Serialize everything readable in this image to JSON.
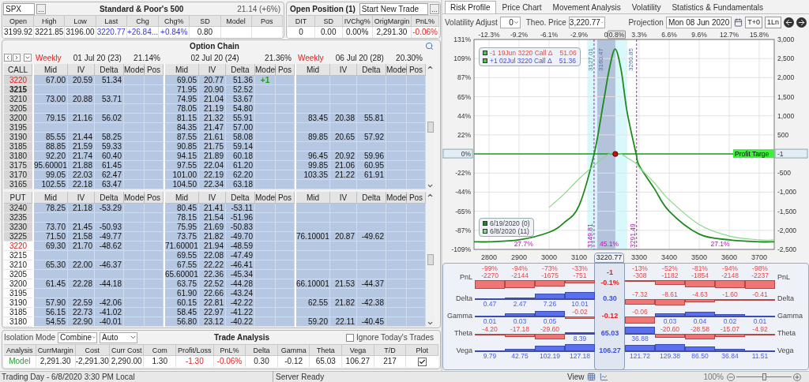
{
  "quote": {
    "symbol": "SPX",
    "browse": "...",
    "title": "Standard & Poor's 500",
    "iv": "21.14 (+6%)",
    "columns": [
      {
        "label": "Open",
        "value": "3199.92"
      },
      {
        "label": "High",
        "value": "3221.85"
      },
      {
        "label": "Low",
        "value": "3196.00"
      },
      {
        "label": "Last",
        "value": "3220.77",
        "kind": "gain"
      },
      {
        "label": "Chg",
        "value": "+26.84...",
        "kind": "gain"
      },
      {
        "label": "Chg%",
        "value": "+0.84%",
        "kind": "gain"
      },
      {
        "label": "SD",
        "value": "0.80"
      },
      {
        "label": "Model"
      },
      {
        "label": "Pos"
      }
    ]
  },
  "open_position": {
    "title": "Open Position (1)",
    "trade": "Start New Trade",
    "browse": "...",
    "columns": [
      {
        "label": "DIT",
        "value": "0"
      },
      {
        "label": "SD",
        "value": "0.00"
      },
      {
        "label": "IVChg%",
        "value": "0.00%"
      },
      {
        "label": "OrigMargin",
        "value": "2,291.30"
      },
      {
        "label": "PnL%",
        "value": "-0.06%",
        "kind": "loss"
      }
    ]
  },
  "option_chain": {
    "title": "Option Chain",
    "expiries": [
      {
        "tag": "Weekly",
        "date": "01 Jul 20 (23)",
        "iv": "21.14%"
      },
      {
        "date": "02 Jul 20 (24)",
        "iv": "21.36%"
      },
      {
        "tag": "Weekly",
        "date": "06 Jul 20 (28)",
        "iv": "20.30%"
      }
    ],
    "sections": [
      {
        "label": "CALL",
        "headers": [
          [
            "Mid",
            "IV",
            "Delta",
            "Model",
            "Pos"
          ],
          [
            "Mid",
            "IV",
            "Delta",
            "Model",
            "Pos"
          ],
          [
            "Mid",
            "IV",
            "Delta",
            "Model",
            "Pos"
          ]
        ],
        "rows": [
          {
            "strike": "3220",
            "itm": true,
            "position": true,
            "selected": false,
            "expiry_1": {
              "mid": "67.00",
              "iv": "20.59",
              "delta": "51.34"
            },
            "expiry_2": {
              "mid": "69.05",
              "iv": "20.77",
              "delta": "51.36",
              "model": "+1"
            }
          },
          {
            "strike": "3215",
            "itm": true,
            "position": false,
            "selected": true,
            "expiry_2": {
              "mid": "71.95",
              "iv": "20.90",
              "delta": "52.52"
            }
          },
          {
            "strike": "3210",
            "itm": true,
            "position": false,
            "selected": false,
            "expiry_1": {
              "mid": "73.00",
              "iv": "20.88",
              "delta": "53.71"
            },
            "expiry_2": {
              "mid": "74.95",
              "iv": "21.04",
              "delta": "53.67"
            }
          },
          {
            "strike": "3205",
            "itm": true,
            "position": false,
            "selected": false,
            "expiry_2": {
              "mid": "78.05",
              "iv": "21.19",
              "delta": "54.80"
            }
          },
          {
            "strike": "3200",
            "itm": true,
            "position": false,
            "selected": false,
            "expiry_1": {
              "mid": "79.15",
              "iv": "21.16",
              "delta": "56.02"
            },
            "expiry_2": {
              "mid": "81.15",
              "iv": "21.32",
              "delta": "55.91"
            },
            "expiry_3": {
              "mid": "83.45",
              "iv": "20.38",
              "delta": "55.81"
            }
          },
          {
            "strike": "3195",
            "itm": true,
            "position": false,
            "selected": false,
            "expiry_2": {
              "mid": "84.35",
              "iv": "21.47",
              "delta": "57.00"
            }
          },
          {
            "strike": "3190",
            "itm": true,
            "position": false,
            "selected": false,
            "expiry_1": {
              "mid": "85.55",
              "iv": "21.44",
              "delta": "58.25"
            },
            "expiry_2": {
              "mid": "87.55",
              "iv": "21.61",
              "delta": "58.08"
            },
            "expiry_3": {
              "mid": "89.85",
              "iv": "20.65",
              "delta": "57.92"
            }
          },
          {
            "strike": "3185",
            "itm": true,
            "position": false,
            "selected": false,
            "expiry_1": {
              "mid": "88.85",
              "iv": "21.59",
              "delta": "59.33"
            },
            "expiry_2": {
              "mid": "90.85",
              "iv": "21.75",
              "delta": "59.14"
            }
          },
          {
            "strike": "3180",
            "itm": true,
            "position": false,
            "selected": false,
            "expiry_1": {
              "mid": "92.20",
              "iv": "21.74",
              "delta": "60.40"
            },
            "expiry_2": {
              "mid": "94.15",
              "iv": "21.89",
              "delta": "60.18"
            },
            "expiry_3": {
              "mid": "96.45",
              "iv": "20.92",
              "delta": "59.96"
            }
          },
          {
            "strike": "3175",
            "itm": true,
            "position": false,
            "selected": false,
            "expiry_1": {
              "mid": "95.60001",
              "iv": "21.88",
              "delta": "61.45"
            },
            "expiry_2": {
              "mid": "97.55",
              "iv": "22.04",
              "delta": "61.20"
            },
            "expiry_3": {
              "mid": "99.85",
              "iv": "21.06",
              "delta": "60.95"
            }
          },
          {
            "strike": "3170",
            "itm": true,
            "position": false,
            "selected": false,
            "expiry_1": {
              "mid": "99.05",
              "iv": "22.03",
              "delta": "62.47"
            },
            "expiry_2": {
              "mid": "101.00",
              "iv": "22.19",
              "delta": "62.20"
            },
            "expiry_3": {
              "mid": "103.35",
              "iv": "21.22",
              "delta": "61.91"
            }
          },
          {
            "strike": "3165",
            "itm": true,
            "position": false,
            "selected": false,
            "expiry_1": {
              "mid": "102.55",
              "iv": "22.18",
              "delta": "63.47"
            },
            "expiry_2": {
              "mid": "104.50",
              "iv": "22.34",
              "delta": "63.18"
            }
          }
        ]
      },
      {
        "label": "PUT",
        "headers": [
          [
            "Mid",
            "IV",
            "Delta",
            "Model",
            "Pos"
          ],
          [
            "Mid",
            "IV",
            "Delta",
            "Model",
            "Pos"
          ],
          [
            "Mid",
            "IV",
            "Delta",
            "Model",
            "Pos"
          ]
        ],
        "rows": [
          {
            "strike": "3240",
            "itm": true,
            "position": false,
            "selected": false,
            "expiry_1": {
              "mid": "78.25",
              "iv": "21.18",
              "delta": "-53.29"
            },
            "expiry_2": {
              "mid": "80.45",
              "iv": "21.41",
              "delta": "-53.11"
            }
          },
          {
            "strike": "3235",
            "itm": true,
            "position": false,
            "selected": false,
            "expiry_2": {
              "mid": "78.15",
              "iv": "21.54",
              "delta": "-51.96"
            }
          },
          {
            "strike": "3230",
            "itm": true,
            "position": false,
            "selected": false,
            "expiry_1": {
              "mid": "73.70",
              "iv": "21.45",
              "delta": "-50.93"
            },
            "expiry_2": {
              "mid": "75.95",
              "iv": "21.69",
              "delta": "-50.83"
            }
          },
          {
            "strike": "3225",
            "itm": true,
            "position": false,
            "selected": false,
            "expiry_1": {
              "mid": "71.50",
              "iv": "21.58",
              "delta": "-49.77"
            },
            "expiry_2": {
              "mid": "73.75",
              "iv": "21.82",
              "delta": "-49.70"
            },
            "expiry_3": {
              "mid": "76.10001",
              "iv": "20.87",
              "delta": "-49.62"
            }
          },
          {
            "strike": "3220",
            "itm": false,
            "position": true,
            "selected": false,
            "expiry_1": {
              "mid": "69.30",
              "iv": "21.70",
              "delta": "-48.62"
            },
            "expiry_2": {
              "mid": "71.60001",
              "iv": "21.94",
              "delta": "-48.59"
            }
          },
          {
            "strike": "3215",
            "itm": false,
            "position": false,
            "selected": false,
            "expiry_2": {
              "mid": "69.55",
              "iv": "22.08",
              "delta": "-47.49"
            }
          },
          {
            "strike": "3210",
            "itm": false,
            "position": false,
            "selected": false,
            "expiry_1": {
              "mid": "65.30",
              "iv": "22.00",
              "delta": "-46.37"
            },
            "expiry_2": {
              "mid": "67.55",
              "iv": "22.22",
              "delta": "-46.41"
            }
          },
          {
            "strike": "3205",
            "itm": false,
            "position": false,
            "selected": false,
            "expiry_2": {
              "mid": "65.60001",
              "iv": "22.36",
              "delta": "-45.34"
            }
          },
          {
            "strike": "3200",
            "itm": false,
            "position": false,
            "selected": false,
            "expiry_1": {
              "mid": "61.45",
              "iv": "22.28",
              "delta": "-44.18"
            },
            "expiry_2": {
              "mid": "63.75",
              "iv": "22.52",
              "delta": "-44.28"
            },
            "expiry_3": {
              "mid": "66.10001",
              "iv": "21.53",
              "delta": "-44.37"
            }
          },
          {
            "strike": "3195",
            "itm": false,
            "position": false,
            "selected": false,
            "expiry_2": {
              "mid": "61.90",
              "iv": "22.66",
              "delta": "-43.24"
            }
          },
          {
            "strike": "3190",
            "itm": false,
            "position": false,
            "selected": false,
            "expiry_1": {
              "mid": "57.90",
              "iv": "22.59",
              "delta": "-42.06"
            },
            "expiry_2": {
              "mid": "60.15",
              "iv": "22.81",
              "delta": "-42.22"
            },
            "expiry_3": {
              "mid": "62.55",
              "iv": "21.82",
              "delta": "-42.38"
            }
          },
          {
            "strike": "3185",
            "itm": false,
            "position": false,
            "selected": false,
            "expiry_1": {
              "mid": "56.15",
              "iv": "22.73",
              "delta": "-41.02"
            },
            "expiry_2": {
              "mid": "58.45",
              "iv": "22.97",
              "delta": "-41.22"
            }
          },
          {
            "strike": "3180",
            "itm": false,
            "position": false,
            "selected": false,
            "expiry_1": {
              "mid": "54.55",
              "iv": "22.90",
              "delta": "-40.01"
            },
            "expiry_2": {
              "mid": "56.80",
              "iv": "23.12",
              "delta": "-40.22"
            },
            "expiry_3": {
              "mid": "59.20",
              "iv": "22.11",
              "delta": "-40.45"
            }
          }
        ]
      }
    ]
  },
  "trade_analysis": {
    "isolation_label": "Isolation Mode",
    "mode": "Combine",
    "sizing": "Auto",
    "title": "Trade Analysis",
    "ignore_todays_trades": {
      "label": "Ignore Today's Trades",
      "checked": false
    },
    "columns": [
      {
        "label": "Analysis",
        "value": "Model",
        "kind": "model"
      },
      {
        "label": "CurrMargin",
        "value": "2,291.30"
      },
      {
        "label": "Cost",
        "value": "-2,291.30"
      },
      {
        "label": "Curr Cost",
        "value": "2,290.00"
      },
      {
        "label": "Com",
        "value": "1.30"
      },
      {
        "label": "Profit/Loss",
        "value": "-1.30",
        "kind": "loss"
      },
      {
        "label": "PnL%",
        "value": "-0.06%",
        "kind": "loss"
      },
      {
        "label": "Delta",
        "value": "0.30"
      },
      {
        "label": "Gamma",
        "value": "-0.12"
      },
      {
        "label": "Theta",
        "value": "65.03"
      },
      {
        "label": "Vega",
        "value": "106.27"
      },
      {
        "label": "T/D",
        "value": "217"
      },
      {
        "label": "Plot",
        "kind": "checkbox",
        "checked": true
      }
    ]
  },
  "right_tabs": [
    {
      "label": "Risk Profile",
      "selected": true
    },
    {
      "label": "Price Chart",
      "selected": false
    },
    {
      "label": "Movement Analysis",
      "selected": false
    },
    {
      "label": "Volatility",
      "selected": false
    },
    {
      "label": "Statistics & Fundamentals",
      "selected": false
    }
  ],
  "risk_controls": {
    "volatility_label": "Volatility Adjust",
    "volatility": "0",
    "theo_label": "Theo. Price",
    "theo_price": "3,220.77",
    "projection_label": "Projection",
    "projection": "Mon 08 Jun 2020",
    "buttons": [
      "T+0",
      "1Ln"
    ]
  },
  "risk_profile": {
    "top_axis": [
      {
        "label": "-12.3%",
        "selected": false
      },
      {
        "label": "-9.2%",
        "selected": false
      },
      {
        "label": "-6.1%",
        "selected": false
      },
      {
        "label": "-2.9%",
        "selected": false
      },
      {
        "label": "0",
        "selected": false
      },
      {
        "label": "0.8%",
        "selected": true
      },
      {
        "label": "3.3%",
        "selected": false
      },
      {
        "label": "6.6%",
        "selected": false
      },
      {
        "label": "9.6%",
        "selected": false
      },
      {
        "label": "12.7%",
        "selected": false
      },
      {
        "label": "15.8%",
        "selected": false
      }
    ],
    "percent_ticks": [
      "131%",
      "109%",
      "87%",
      "65%",
      "44%",
      "22%",
      "0%",
      "-22%",
      "-44%",
      "-65%",
      "-87%",
      "-109%"
    ],
    "positions": [
      {
        "text": "-1 19Jun 3220 Call Δ",
        "delta": "51.06",
        "kind": "short"
      },
      {
        "text": "+1 02Jul 3220 Call Δ",
        "delta": "51.36",
        "kind": "long"
      }
    ],
    "bands": [
      "3127.01",
      "3160.47",
      "3260.85"
    ],
    "probabilities": [
      "27.7%",
      "45.1%",
      "27.1%"
    ],
    "profit_target": "Profit Targe",
    "current_pnl": "-1",
    "current_price": "3220.77",
    "chart_data": {
      "type": "line",
      "x": [
        2750,
        2800,
        2900,
        3000,
        3050,
        3100,
        3150,
        3180,
        3200,
        3220,
        3240,
        3260,
        3290,
        3300,
        3350,
        3400,
        3500,
        3600,
        3700,
        3750
      ],
      "series": [
        {
          "name": "6/19/2020 (0)",
          "color": "#1e8a1e",
          "values": [
            -2300,
            -2300,
            -2250,
            -2050,
            -1800,
            -1350,
            0,
            1300,
            2200,
            2750,
            2200,
            1100,
            0,
            -300,
            -900,
            -1500,
            -2100,
            -2250,
            -2300,
            -2300
          ]
        },
        {
          "name": "6/8/2020 (11)",
          "color": "#86d886",
          "values": [
            null,
            null,
            null,
            -1400,
            -1050,
            -650,
            -300,
            -100,
            0,
            0,
            0,
            -100,
            -250,
            -350,
            -750,
            -1200,
            -1850,
            -2150,
            -2250,
            -2250
          ]
        }
      ],
      "xlim": [
        2750,
        3750
      ],
      "ylim": [
        -2500,
        3000
      ],
      "grid": true,
      "legend": true,
      "ref_lines": [
        {
          "axis": "y",
          "value": 0,
          "color": "#1c9a1c"
        },
        {
          "axis": "x",
          "value": 3149.81,
          "label": "3149.81",
          "color": "#b020b0"
        },
        {
          "axis": "x",
          "value": 3291.49,
          "label": "3291.49",
          "color": "#b020b0"
        }
      ],
      "xticks": [
        2800,
        2900,
        3000,
        3100,
        3300,
        3400,
        3500,
        3600,
        3700
      ],
      "yticks": [
        {
          "value": 3000,
          "label": "3,000"
        },
        {
          "value": 2500,
          "label": "2,500"
        },
        {
          "value": 2000,
          "label": "2,000"
        },
        {
          "value": 1500,
          "label": "1,500"
        },
        {
          "value": 1000,
          "label": "1,000"
        },
        {
          "value": 500,
          "label": "500"
        },
        {
          "value": -500,
          "label": "-500"
        },
        {
          "value": -1000,
          "label": "-1,000"
        },
        {
          "value": -1500,
          "label": "-1,500"
        },
        {
          "value": -2000,
          "label": "-2,000"
        },
        {
          "value": -2500,
          "label": "-2,500"
        }
      ]
    }
  },
  "greeks": {
    "rows": [
      {
        "label": "PnL",
        "label_right": "PnL",
        "center": "-1",
        "center_pct": "-0.1%",
        "cells": [
          {
            "pct": "-99%",
            "value": "-2270"
          },
          {
            "pct": "-94%",
            "value": "-2144"
          },
          {
            "pct": "-73%",
            "value": "-1675"
          },
          {
            "pct": "-33%",
            "value": "-751"
          },
          {
            "pct": "-13%",
            "value": "-308"
          },
          {
            "pct": "-52%",
            "value": "-1182"
          },
          {
            "pct": "-81%",
            "value": "-1854"
          },
          {
            "pct": "-94%",
            "value": "-2148"
          },
          {
            "pct": "-98%",
            "value": "-2237"
          }
        ]
      },
      {
        "label": "Delta",
        "label_right": "Delta",
        "center": "0.30",
        "cells": [
          {
            "value": "0.47"
          },
          {
            "value": "2.47"
          },
          {
            "value": "7.26"
          },
          {
            "value": "10.01"
          },
          {
            "value": "-7.32"
          },
          {
            "value": "-8.61"
          },
          {
            "value": "-4.63"
          },
          {
            "value": "-1.60"
          },
          {
            "value": "-0.41"
          }
        ]
      },
      {
        "label": "Gamma",
        "label_right": "Gamma",
        "center": "-0.12",
        "cells": [
          {
            "value": "0.01"
          },
          {
            "value": "0.03"
          },
          {
            "value": "0.05"
          },
          {
            "value": "-0.02"
          },
          {
            "value": "-0.06"
          },
          {
            "value": "0.03"
          },
          {
            "value": "0.04"
          },
          {
            "value": "0.02"
          },
          {
            "value": "0.01"
          }
        ]
      },
      {
        "label": "Theta",
        "label_right": "Theta",
        "center": "65.03",
        "cells": [
          {
            "value": "-4.20"
          },
          {
            "value": "-17.18"
          },
          {
            "value": "-29.60"
          },
          {
            "value": "8.39"
          },
          {
            "value": "36.88"
          },
          {
            "value": "-20.60"
          },
          {
            "value": "-28.58"
          },
          {
            "value": "-15.07"
          },
          {
            "value": "-4.92"
          }
        ]
      },
      {
        "label": "Vega",
        "label_right": "Vega",
        "center": "106.27",
        "cells": [
          {
            "value": "9.79"
          },
          {
            "value": "42.75"
          },
          {
            "value": "102.19"
          },
          {
            "value": "127.18"
          },
          {
            "value": "121.72"
          },
          {
            "value": "129.38"
          },
          {
            "value": "86.50"
          },
          {
            "value": "36.84"
          },
          {
            "value": "11.51"
          }
        ]
      }
    ]
  },
  "status_bar": {
    "left": "Trading Day - 6/8/2020 3:30 PM Local",
    "center": "Server Ready",
    "view": "View",
    "zoom": "100%",
    "zoom_slider": {
      "level": 0.5
    }
  }
}
